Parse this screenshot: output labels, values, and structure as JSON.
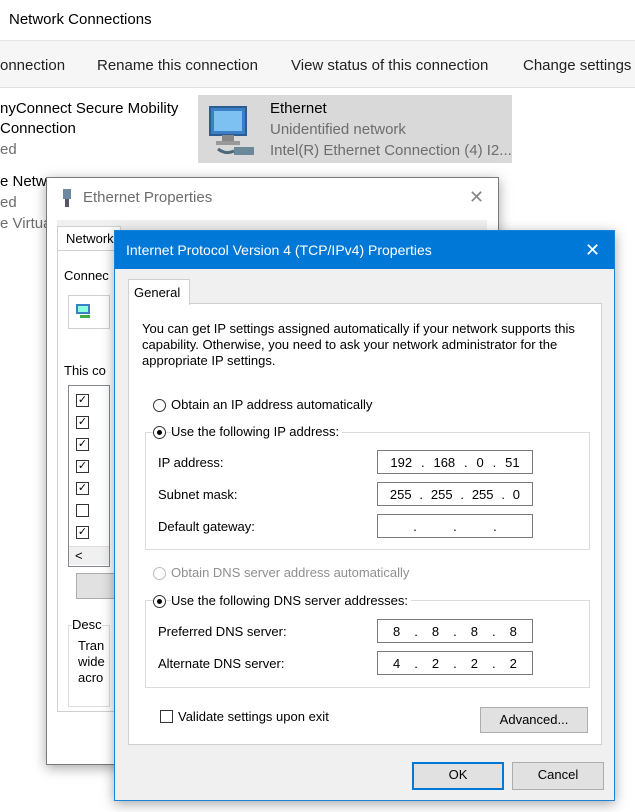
{
  "window": {
    "title": "Network Connections"
  },
  "commands": [
    "onnection",
    "Rename this connection",
    "View status of this connection",
    "Change settings o"
  ],
  "connections": {
    "left_lines": [
      "nyConnect Secure Mobility",
      "Connection",
      "ed",
      "e Netw",
      "ed",
      "e Virtua"
    ],
    "ethernet": {
      "name": "Ethernet",
      "status": "Unidentified network",
      "device": "Intel(R) Ethernet Connection (4) I2..."
    }
  },
  "eth_props": {
    "title": "Ethernet Properties",
    "tab": "Network",
    "connect_label": "Connec",
    "this_conn_label": "This co",
    "items_checked": [
      true,
      true,
      true,
      true,
      true,
      false,
      true
    ],
    "scroll_left": "<",
    "desc_label": "Desc",
    "desc_lines": [
      "Tran",
      "wide",
      "acro"
    ]
  },
  "ipv4": {
    "title": "Internet Protocol Version 4 (TCP/IPv4) Properties",
    "tab": "General",
    "description": "You can get IP settings assigned automatically if your network supports this capability. Otherwise, you need to ask your network administrator for the appropriate IP settings.",
    "radio_auto_ip": "Obtain an IP address automatically",
    "radio_manual_ip": "Use the following IP address:",
    "ip_label": "IP address:",
    "ip_value": [
      "192",
      "168",
      "0",
      "51"
    ],
    "mask_label": "Subnet mask:",
    "mask_value": [
      "255",
      "255",
      "255",
      "0"
    ],
    "gateway_label": "Default gateway:",
    "gateway_value": [
      "",
      "",
      "",
      ""
    ],
    "radio_auto_dns": "Obtain DNS server address automatically",
    "radio_manual_dns": "Use the following DNS server addresses:",
    "pref_dns_label": "Preferred DNS server:",
    "pref_dns_value": [
      "8",
      "8",
      "8",
      "8"
    ],
    "alt_dns_label": "Alternate DNS server:",
    "alt_dns_value": [
      "4",
      "2",
      "2",
      "2"
    ],
    "validate_label": "Validate settings upon exit",
    "advanced_button": "Advanced...",
    "ok_button": "OK",
    "cancel_button": "Cancel",
    "close_glyph": "✕"
  }
}
